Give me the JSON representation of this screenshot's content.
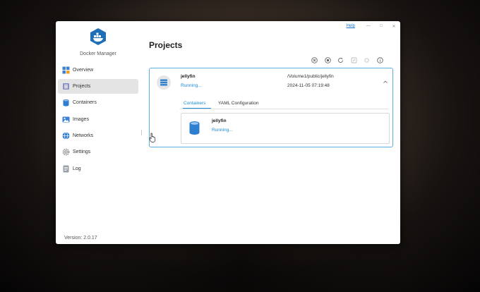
{
  "app": {
    "name": "Docker Manager",
    "version": "Version: 2.0.17"
  },
  "topbar": {
    "help": "Help",
    "minimize": "—",
    "maximize": "□",
    "close": "✕"
  },
  "sidebar": {
    "items": [
      {
        "label": "Overview",
        "icon": "overview-icon"
      },
      {
        "label": "Projects",
        "icon": "projects-icon",
        "active": true
      },
      {
        "label": "Containers",
        "icon": "containers-icon"
      },
      {
        "label": "Images",
        "icon": "images-icon"
      },
      {
        "label": "Networks",
        "icon": "networks-icon"
      },
      {
        "label": "Settings",
        "icon": "gear-icon"
      },
      {
        "label": "Log",
        "icon": "log-icon"
      }
    ]
  },
  "main": {
    "title": "Projects",
    "toolbar": [
      "start-icon",
      "stop-icon",
      "restart-icon",
      "edit-icon",
      "delete-icon",
      "info-icon"
    ],
    "project": {
      "name": "jellyfin",
      "status": "Running...",
      "path": "/Volume1/public/jellyfin",
      "time": "2024-11-05 07:19:48",
      "tabs": [
        {
          "label": "Containers",
          "active": true
        },
        {
          "label": "YAML Configuration"
        }
      ],
      "container": {
        "name": "jellyfin",
        "status": "Running..."
      }
    }
  },
  "colors": {
    "accent": "#1a8ad6",
    "docker_blue": "#1e6fb8",
    "card_border": "#5aaee0"
  }
}
